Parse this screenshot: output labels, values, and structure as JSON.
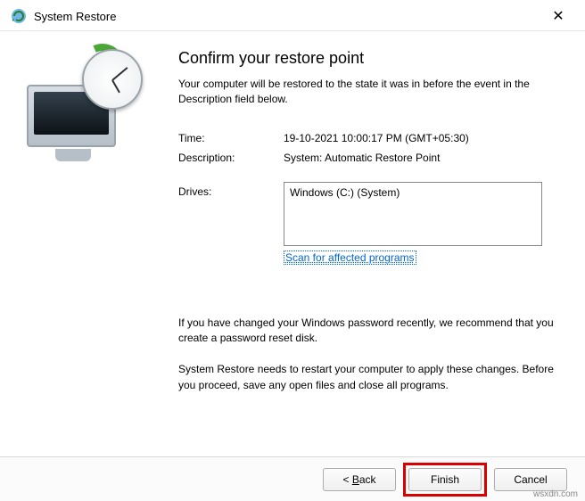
{
  "title": "System Restore",
  "heading": "Confirm your restore point",
  "subtitle": "Your computer will be restored to the state it was in before the event in the Description field below.",
  "fields": {
    "time_label": "Time:",
    "time_value": "19-10-2021 10:00:17 PM (GMT+05:30)",
    "desc_label": "Description:",
    "desc_value": "System: Automatic Restore Point",
    "drives_label": "Drives:",
    "drives_value": "Windows (C:) (System)"
  },
  "scan_link": "Scan for affected programs",
  "note1": "If you have changed your Windows password recently, we recommend that you create a password reset disk.",
  "note2": "System Restore needs to restart your computer to apply these changes. Before you proceed, save any open files and close all programs.",
  "buttons": {
    "back_prefix": "< ",
    "back_u": "B",
    "back_rest": "ack",
    "finish": "Finish",
    "cancel": "Cancel"
  },
  "watermark": "wsxdn.com"
}
